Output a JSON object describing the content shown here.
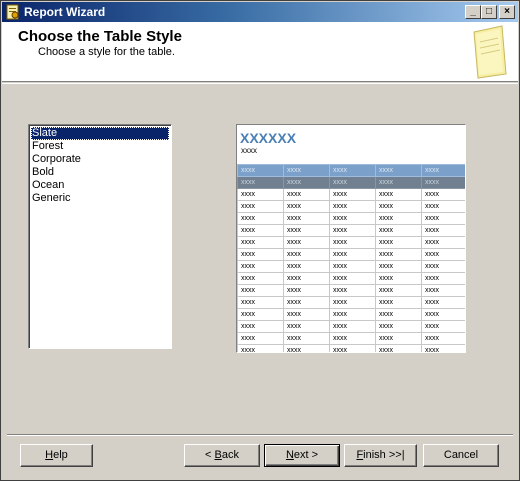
{
  "window": {
    "title": "Report Wizard"
  },
  "titlebar_buttons": {
    "minimize": "_",
    "maximize": "□",
    "close": "×"
  },
  "header": {
    "title": "Choose the Table Style",
    "subtitle": "Choose a style for the table."
  },
  "style_list": {
    "items": [
      "Slate",
      "Forest",
      "Corporate",
      "Bold",
      "Ocean",
      "Generic"
    ],
    "selected": "Slate"
  },
  "preview": {
    "title": "XXXXXX",
    "subtitle": "xxxx",
    "cell_text": "xxxx",
    "columns": 5,
    "body_rows": 14,
    "colors": {
      "header_row": "#7ba0c9",
      "group_row": "#708090",
      "title": "#4a7fb5"
    }
  },
  "buttons": {
    "help": {
      "pre": "",
      "key": "H",
      "post": "elp"
    },
    "back": {
      "pre": "< ",
      "key": "B",
      "post": "ack"
    },
    "next": {
      "pre": "",
      "key": "N",
      "post": "ext >"
    },
    "finish": {
      "pre": "",
      "key": "F",
      "post": "inish >>|"
    },
    "cancel": {
      "label": "Cancel"
    }
  }
}
